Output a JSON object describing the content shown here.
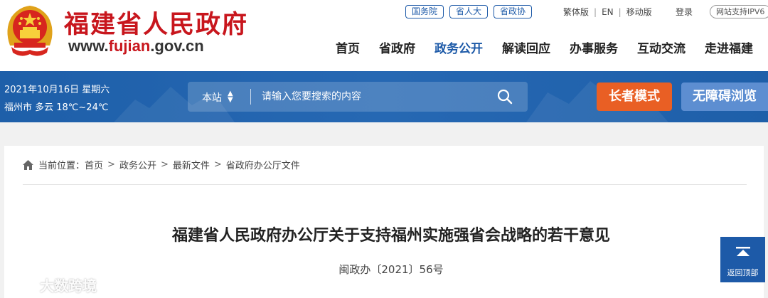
{
  "site": {
    "name": "福建省人民政府",
    "url_prefix": "www.",
    "url_highlight": "fujian",
    "url_suffix": ".gov.cn"
  },
  "quick_links": [
    "国务院",
    "省人大",
    "省政协"
  ],
  "util_links": [
    "繁体版",
    "EN",
    "移动版"
  ],
  "login": "登录",
  "ipv6": "网站支持IPV6",
  "nav": [
    "首页",
    "省政府",
    "政务公开",
    "解读回应",
    "办事服务",
    "互动交流",
    "走进福建"
  ],
  "nav_active": "政务公开",
  "info": {
    "date": "2021年10月16日 星期六",
    "weather": "福州市 多云 18℃~24℃"
  },
  "search": {
    "scope": "本站",
    "placeholder": "请输入您要搜索的内容"
  },
  "buttons": {
    "elder_mode": "长者模式",
    "accessible": "无障碍浏览"
  },
  "breadcrumb": {
    "label": "当前位置：",
    "items": [
      "首页",
      "政务公开",
      "最新文件",
      "省政府办公厅文件"
    ]
  },
  "article": {
    "title": "福建省人民政府办公厅关于支持福州实施强省会战略的若干意见",
    "doc_number": "闽政办〔2021〕56号"
  },
  "back_to_top": "返回顶部",
  "watermark": "大数跨境",
  "colors": {
    "brand_red": "#c8161d",
    "brand_blue": "#1d5aa8",
    "elder_orange": "#e95f24",
    "access_blue": "#5d8ed1"
  }
}
